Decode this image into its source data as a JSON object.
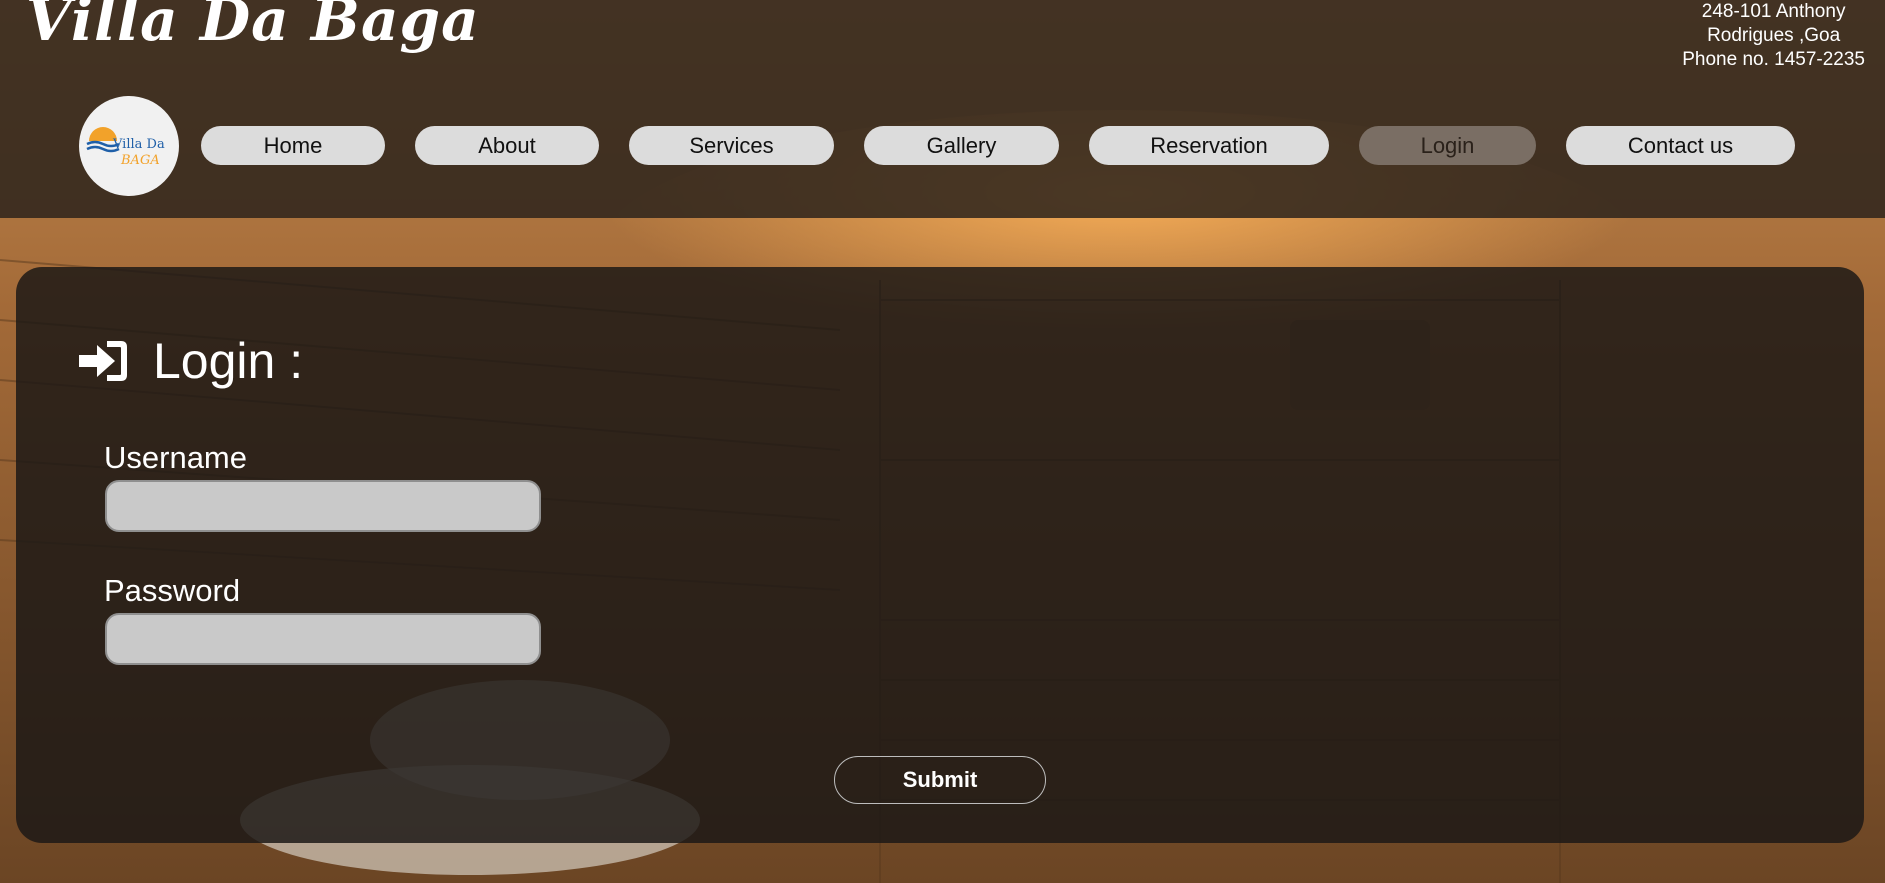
{
  "site": {
    "title": "Villa Da Baga",
    "address_line1": "248-101 Anthony",
    "address_line2": "Rodrigues ,Goa",
    "phone": "Phone no. 1457-2235",
    "logo_text_top": "Villa Da",
    "logo_text_bottom": "BAGA"
  },
  "nav": {
    "home": "Home",
    "about": "About",
    "services": "Services",
    "gallery": "Gallery",
    "reservation": "Reservation",
    "login": "Login",
    "contact": "Contact us",
    "active": "login"
  },
  "login": {
    "heading": "Login :",
    "username_label": "Username",
    "username_value": "",
    "password_label": "Password",
    "password_value": "",
    "submit_label": "Submit"
  },
  "colors": {
    "nav_bg": "#dcdcdc",
    "nav_active_bg": "#7a6e64",
    "panel_bg": "#1c1815",
    "logo_blue": "#1f5fa8",
    "logo_orange": "#f2a22a"
  },
  "icons": {
    "login": "sign-in-icon",
    "logo": "sun-waves-logo"
  }
}
